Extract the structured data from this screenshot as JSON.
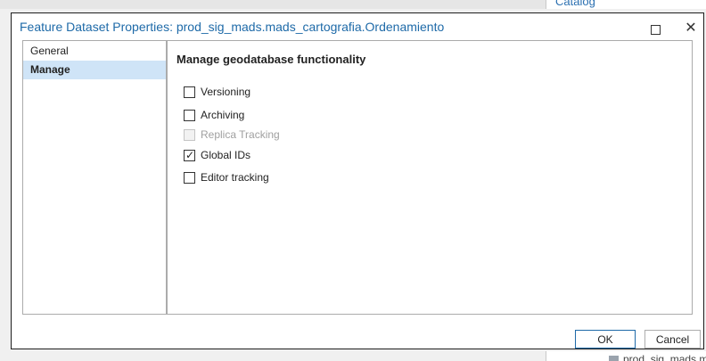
{
  "background": {
    "catalog_tab_label": "Catalog",
    "bottom_item_label": "prod_sig_mads.m"
  },
  "dialog": {
    "title": "Feature Dataset Properties: prod_sig_mads.mads_cartografia.Ordenamiento",
    "maximize_symbol": "",
    "close_symbol": "✕"
  },
  "nav": {
    "items": [
      {
        "label": "General",
        "selected": false
      },
      {
        "label": "Manage",
        "selected": true
      }
    ]
  },
  "content": {
    "section_title": "Manage geodatabase functionality",
    "options": [
      {
        "label": "Versioning",
        "checked": false,
        "enabled": true
      },
      {
        "label": "Archiving",
        "checked": false,
        "enabled": true
      },
      {
        "label": "Replica Tracking",
        "checked": false,
        "enabled": false
      },
      {
        "label": "Global IDs",
        "checked": true,
        "enabled": true
      },
      {
        "label": "Editor tracking",
        "checked": false,
        "enabled": true
      }
    ],
    "check_glyph": "✓"
  },
  "footer": {
    "ok_label": "OK",
    "cancel_label": "Cancel"
  },
  "colors": {
    "title_text": "#1e6aa8",
    "nav_selected_bg": "#cfe4f7"
  }
}
